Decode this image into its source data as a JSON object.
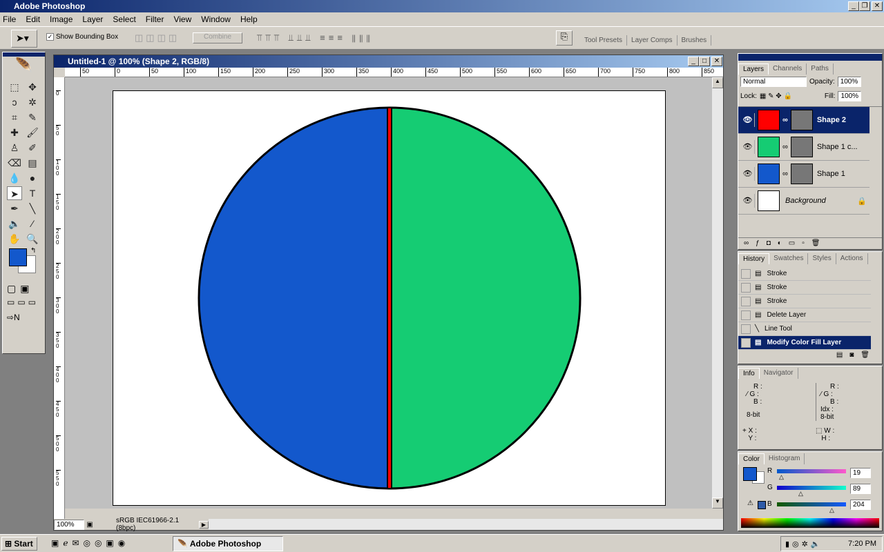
{
  "app": {
    "title": "Adobe Photoshop"
  },
  "menu": [
    "File",
    "Edit",
    "Image",
    "Layer",
    "Select",
    "Filter",
    "View",
    "Window",
    "Help"
  ],
  "options": {
    "show_bounding_box": "Show Bounding Box",
    "show_bounding_box_checked": true,
    "combine": "Combine"
  },
  "palette_well": {
    "tabs": [
      "Tool Presets",
      "Layer Comps",
      "Brushes"
    ]
  },
  "document": {
    "title": "Untitled-1 @ 100% (Shape 2, RGB/8)",
    "zoom": "100%",
    "status": "sRGB IEC61966-2.1 (8bpc)",
    "ruler_top": [
      "50",
      "0",
      "50",
      "100",
      "150",
      "200",
      "250",
      "300",
      "350",
      "400",
      "450",
      "500",
      "550",
      "600",
      "650",
      "700",
      "750",
      "800",
      "850"
    ],
    "ruler_left": [
      "0",
      "5 0",
      "1 0 0",
      "1 5 0",
      "2 0 0",
      "2 5 0",
      "3 0 0",
      "3 5 0",
      "4 0 0",
      "4 5 0",
      "5 0 0",
      "5 5 0"
    ],
    "shapes": {
      "left_fill": "#1358cc",
      "right_fill": "#15cc73",
      "divider": "#ff0000",
      "stroke": "#000000"
    }
  },
  "layers_panel": {
    "tabs": [
      "Layers",
      "Channels",
      "Paths"
    ],
    "blend": "Normal",
    "opacity_label": "Opacity:",
    "opacity": "100%",
    "lock_label": "Lock:",
    "fill_label": "Fill:",
    "fill": "100%",
    "layers": [
      {
        "name": "Shape 2",
        "color": "#ff0000",
        "selected": true
      },
      {
        "name": "Shape 1 c...",
        "color": "#15cc73"
      },
      {
        "name": "Shape 1",
        "color": "#1358cc"
      },
      {
        "name": "Background",
        "color": "#ffffff"
      }
    ]
  },
  "history_panel": {
    "tabs": [
      "History",
      "Swatches",
      "Styles",
      "Actions"
    ],
    "items": [
      "Stroke",
      "Stroke",
      "Stroke",
      "Delete Layer",
      "Line Tool",
      "Modify Color Fill Layer"
    ]
  },
  "info_panel": {
    "tabs": [
      "Info",
      "Navigator"
    ],
    "left": [
      "R :",
      "G :",
      "B :",
      "8-bit"
    ],
    "right": [
      "R :",
      "G :",
      "B :",
      "Idx :",
      "8-bit"
    ],
    "xy": [
      "X :",
      "Y :"
    ],
    "wh": [
      "W :",
      "H :"
    ]
  },
  "color_panel": {
    "tabs": [
      "Color",
      "Histogram"
    ],
    "r_label": "R",
    "g_label": "G",
    "b_label": "B",
    "r": "19",
    "g": "89",
    "b": "204",
    "foreground": "#1358cc",
    "background": "#ffffff"
  },
  "taskbar": {
    "start": "Start",
    "task": "Adobe Photoshop",
    "clock": "7:20 PM"
  }
}
